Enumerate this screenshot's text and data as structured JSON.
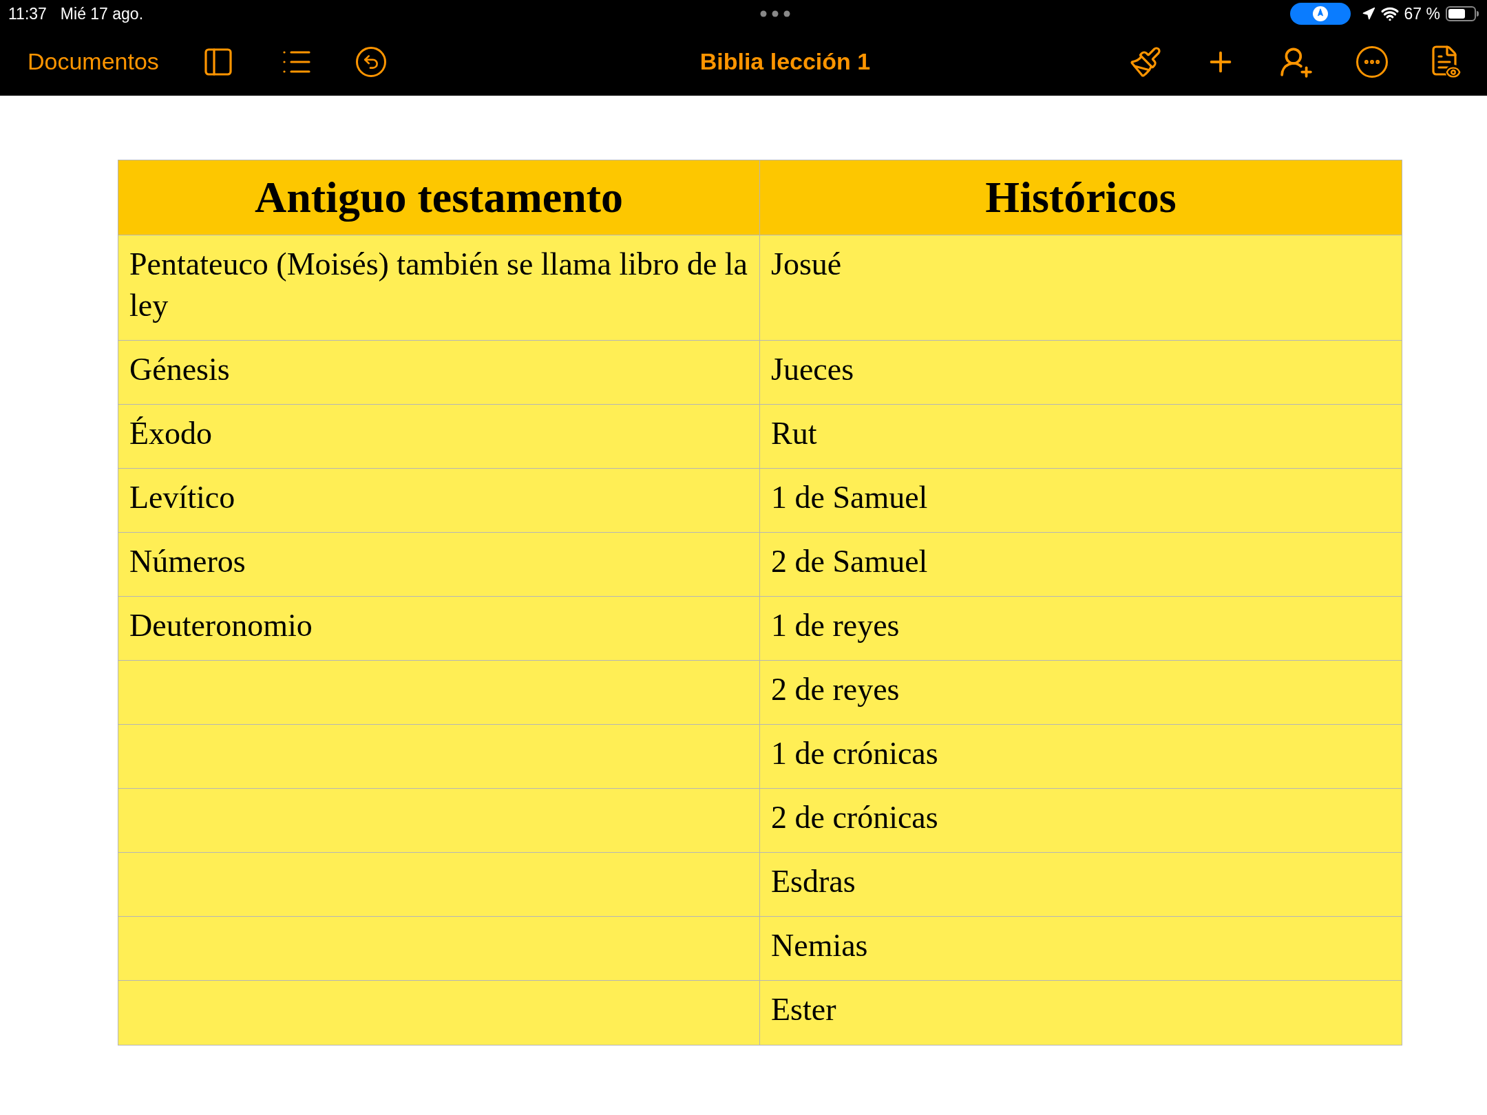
{
  "status_bar": {
    "time": "11:37",
    "date": "Mié 17 ago.",
    "battery_text": "67 %"
  },
  "toolbar": {
    "back_label": "Documentos",
    "title": "Biblia lección 1"
  },
  "table": {
    "columns": [
      "Antiguo testamento",
      "Históricos"
    ],
    "rows": [
      {
        "left": "Pentateuco (Moisés) también se llama libro de la ley",
        "right": "Josué"
      },
      {
        "left": "Génesis",
        "right": "Jueces"
      },
      {
        "left": "Éxodo",
        "right": "Rut"
      },
      {
        "left": "Levítico",
        "right": "1 de Samuel"
      },
      {
        "left": "Números",
        "right": "2 de Samuel"
      },
      {
        "left": "Deuteronomio",
        "right": "1 de reyes"
      },
      {
        "right": "2 de reyes"
      },
      {
        "right": "1 de crónicas"
      },
      {
        "right": "2 de crónicas"
      },
      {
        "right": "Esdras"
      },
      {
        "right": "Nemias"
      },
      {
        "right": "Ester"
      }
    ]
  }
}
